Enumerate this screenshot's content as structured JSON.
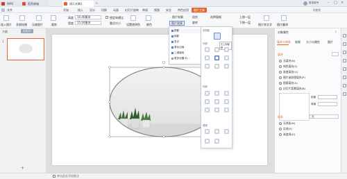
{
  "window_tabs": [
    {
      "label": "WPS",
      "icon": "wps-logo-icon",
      "color": "#d63a2f"
    },
    {
      "label": "稻壳商城",
      "icon": "docer-icon",
      "color": "#e24a3c"
    },
    {
      "label": "演示文稿1",
      "icon": "ppt-icon",
      "color": "#e8632c"
    }
  ],
  "user": {
    "label": "登录账号"
  },
  "menu": {
    "file": "文件",
    "items": [
      "开始",
      "插入",
      "设计",
      "切换",
      "动画",
      "幻灯片放映",
      "审阅",
      "视图",
      "安全",
      "特色应用"
    ],
    "active_tab": "图片工具",
    "search": "Q查找"
  },
  "toolbar": {
    "insert_image": "插入图片",
    "multi_image": "多图轮播",
    "compress": "压缩图片",
    "crop": "裁剪",
    "height_label": "高度",
    "height_value": "10.46厘米",
    "width_label": "宽度",
    "width_value": "15.04厘米",
    "lock_ratio": "锁定纵横比",
    "reset_size": "重设大小",
    "set_transparent": "设置透明色",
    "color": "颜色",
    "image_outline": "图片轮廓",
    "image_effect": "图片效果",
    "combine": "组合",
    "rotate": "旋转",
    "select_pane": "选择窗格",
    "bring_forward": "上移一层",
    "send_backward": "下移一层",
    "image_to_text": "图片转文字",
    "image_translate": "图片翻译"
  },
  "left_pane": {
    "tab_outline": "大纲",
    "tab_slides": "幻灯片",
    "slide_number": "1",
    "add_label": "+"
  },
  "effect_menu": {
    "items": [
      {
        "label": "阴影",
        "icon": "shadow-icon"
      },
      {
        "label": "倒影",
        "icon": "reflection-icon"
      },
      {
        "label": "发光",
        "icon": "glow-icon"
      },
      {
        "label": "柔化边缘",
        "icon": "soft-edge-icon"
      },
      {
        "label": "三维旋转",
        "icon": "3d-rotate-icon"
      },
      {
        "label": "更多设置(E)...",
        "icon": "more-settings-icon"
      }
    ]
  },
  "shadow_panel": {
    "no_shadow_section": "无阴影",
    "outer_section": "外部",
    "inner_section": "内部",
    "perspective_section": "透视",
    "tooltip": "左上斜偏移"
  },
  "right_pane": {
    "title": "对象属性",
    "tabs": [
      "填充与线条",
      "效果",
      "大小与属性",
      "图片"
    ],
    "fill_section": "填充",
    "fill_options": [
      {
        "label": "无填充(N)",
        "selected": false
      },
      {
        "label": "纯色填充(S)",
        "selected": false
      },
      {
        "label": "渐变填充(G)",
        "selected": false
      },
      {
        "label": "图片或纹理填充(P)",
        "selected": false
      },
      {
        "label": "图案填充(A)",
        "selected": true
      },
      {
        "label": "幻灯片背景填充(B)",
        "selected": false
      }
    ],
    "foreground_label": "前景",
    "background_label": "背景",
    "line_section": "线条",
    "line_select_value": "无",
    "line_options": [
      {
        "label": "无线条(N)",
        "selected": true
      },
      {
        "label": "实线(S)",
        "selected": false
      },
      {
        "label": "渐变线(G)",
        "selected": false
      }
    ]
  },
  "status": {
    "note_placeholder": "单击此处添加备注"
  },
  "colors": {
    "accent": "#e8632c",
    "selection": "#4a78d8"
  }
}
